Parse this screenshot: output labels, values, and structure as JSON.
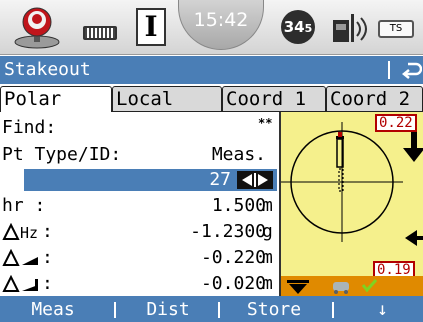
{
  "status_bar": {
    "gps_icon": "gps-receiver-icon",
    "memory_icon": "memory-card-icon",
    "mode_indicator": "I",
    "time": "15:42",
    "satellites": "34",
    "satellites_sub": "5",
    "radio_icon": "radio-antenna-icon",
    "battery_label": "TS"
  },
  "title_bar": {
    "title": "Stakeout",
    "escape_icon": "return-arrow-icon"
  },
  "tabs": [
    "Polar",
    "Local",
    "Coord 1",
    "Coord 2"
  ],
  "form": {
    "find_label": "Find:",
    "find_marker": "**",
    "pt_type_label": "Pt Type/ID:",
    "pt_type_value": "Meas.",
    "point_id_value": "27",
    "hr_label": "hr   :",
    "hr_value": "1.500",
    "hr_unit": "m",
    "dhz_label": ":",
    "dhz_value": "-1.2300",
    "dhz_unit": "g",
    "d_dist_label": ":",
    "d_dist_value": "-0.220",
    "d_dist_unit": "m",
    "d_height_label": ":",
    "d_height_value": "-0.020",
    "d_height_unit": "m"
  },
  "graphic": {
    "readout_top": "0.22",
    "readout_bottom": "0.19",
    "prism_icon": "prism-icon",
    "car_icon": "car-icon",
    "check_icon": "checkmark-icon"
  },
  "softkeys": [
    "Meas",
    "Dist",
    "Store",
    "↓"
  ],
  "colors": {
    "title_blue": "#4a7eb6",
    "panel_yellow": "#f5f08c",
    "readout_red": "#b20000",
    "bar_orange": "#e08a00"
  }
}
